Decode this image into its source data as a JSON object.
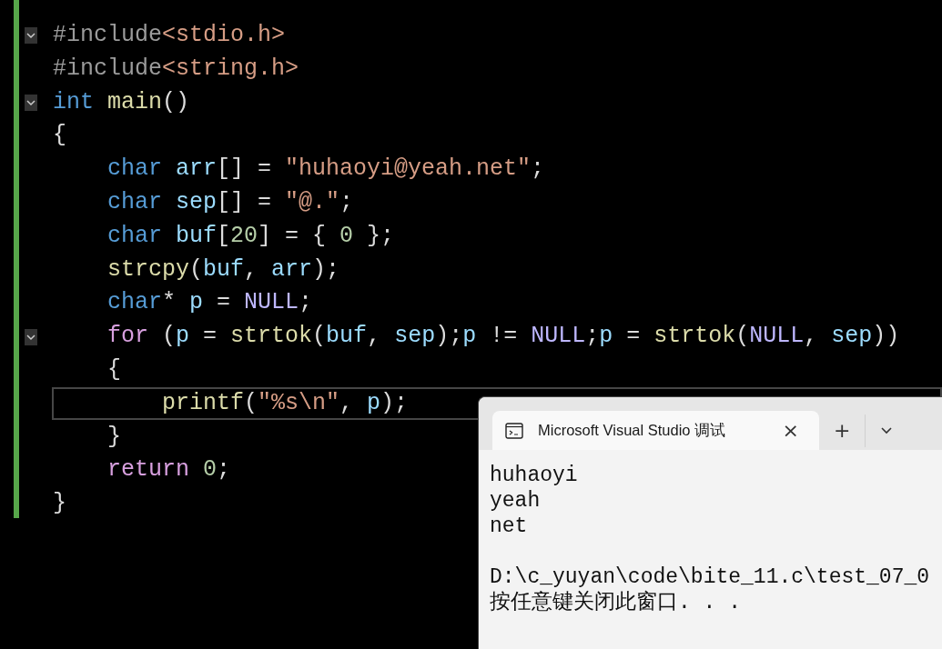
{
  "editor": {
    "lines": [
      {
        "expanded": true,
        "tokens": [
          {
            "kind": "pp",
            "text": "#include"
          },
          {
            "kind": "header",
            "text": "<stdio.h>"
          }
        ]
      },
      {
        "tokens": [
          {
            "kind": "pp",
            "text": "#include"
          },
          {
            "kind": "header",
            "text": "<string.h>"
          }
        ]
      },
      {
        "expanded": true,
        "tokens": [
          {
            "kind": "kw",
            "text": "int "
          },
          {
            "kind": "fn",
            "text": "main"
          },
          {
            "kind": "plain",
            "text": "()"
          }
        ]
      },
      {
        "tokens": [
          {
            "kind": "plain",
            "text": "{"
          }
        ]
      },
      {
        "tokens": [
          {
            "kind": "kw",
            "text": "    char "
          },
          {
            "kind": "var",
            "text": "arr"
          },
          {
            "kind": "plain",
            "text": "[] = "
          },
          {
            "kind": "str",
            "text": "\"huhaoyi@yeah.net\""
          },
          {
            "kind": "plain",
            "text": ";"
          }
        ]
      },
      {
        "tokens": [
          {
            "kind": "kw",
            "text": "    char "
          },
          {
            "kind": "var",
            "text": "sep"
          },
          {
            "kind": "plain",
            "text": "[] = "
          },
          {
            "kind": "str",
            "text": "\"@.\""
          },
          {
            "kind": "plain",
            "text": ";"
          }
        ]
      },
      {
        "tokens": [
          {
            "kind": "kw",
            "text": "    char "
          },
          {
            "kind": "var",
            "text": "buf"
          },
          {
            "kind": "plain",
            "text": "["
          },
          {
            "kind": "num",
            "text": "20"
          },
          {
            "kind": "plain",
            "text": "] = { "
          },
          {
            "kind": "num",
            "text": "0"
          },
          {
            "kind": "plain",
            "text": " };"
          }
        ]
      },
      {
        "tokens": [
          {
            "kind": "fn",
            "text": "    strcpy"
          },
          {
            "kind": "plain",
            "text": "("
          },
          {
            "kind": "var",
            "text": "buf"
          },
          {
            "kind": "plain",
            "text": ", "
          },
          {
            "kind": "var",
            "text": "arr"
          },
          {
            "kind": "plain",
            "text": ");"
          }
        ]
      },
      {
        "tokens": [
          {
            "kind": "kw",
            "text": "    char"
          },
          {
            "kind": "plain",
            "text": "* "
          },
          {
            "kind": "var",
            "text": "p"
          },
          {
            "kind": "plain",
            "text": " = "
          },
          {
            "kind": "macro",
            "text": "NULL"
          },
          {
            "kind": "plain",
            "text": ";"
          }
        ]
      },
      {
        "expanded": true,
        "tokens": [
          {
            "kind": "ctl",
            "text": "    for"
          },
          {
            "kind": "plain",
            "text": " ("
          },
          {
            "kind": "var",
            "text": "p"
          },
          {
            "kind": "plain",
            "text": " = "
          },
          {
            "kind": "fn",
            "text": "strtok"
          },
          {
            "kind": "plain",
            "text": "("
          },
          {
            "kind": "var",
            "text": "buf"
          },
          {
            "kind": "plain",
            "text": ", "
          },
          {
            "kind": "var",
            "text": "sep"
          },
          {
            "kind": "plain",
            "text": ");"
          },
          {
            "kind": "var",
            "text": "p"
          },
          {
            "kind": "plain",
            "text": " != "
          },
          {
            "kind": "macro",
            "text": "NULL"
          },
          {
            "kind": "plain",
            "text": ";"
          },
          {
            "kind": "var",
            "text": "p"
          },
          {
            "kind": "plain",
            "text": " = "
          },
          {
            "kind": "fn",
            "text": "strtok"
          },
          {
            "kind": "plain",
            "text": "("
          },
          {
            "kind": "macro",
            "text": "NULL"
          },
          {
            "kind": "plain",
            "text": ", "
          },
          {
            "kind": "var",
            "text": "sep"
          },
          {
            "kind": "plain",
            "text": "))"
          }
        ]
      },
      {
        "tokens": [
          {
            "kind": "plain",
            "text": "    {"
          }
        ]
      },
      {
        "current": true,
        "tokens": [
          {
            "kind": "fn",
            "text": "        printf"
          },
          {
            "kind": "plain",
            "text": "("
          },
          {
            "kind": "str",
            "text": "\"%s\\n\""
          },
          {
            "kind": "plain",
            "text": ", "
          },
          {
            "kind": "var",
            "text": "p"
          },
          {
            "kind": "plain",
            "text": ");"
          }
        ]
      },
      {
        "tokens": [
          {
            "kind": "plain",
            "text": "    }"
          }
        ]
      },
      {
        "tokens": [
          {
            "kind": "ctl",
            "text": "    return "
          },
          {
            "kind": "num",
            "text": "0"
          },
          {
            "kind": "plain",
            "text": ";"
          }
        ]
      },
      {
        "tokens": [
          {
            "kind": "plain",
            "text": "}"
          }
        ]
      }
    ]
  },
  "console": {
    "tab": {
      "title": "Microsoft Visual Studio 调试",
      "close": "×"
    },
    "new_tab": "+",
    "output": [
      "huhaoyi",
      "yeah",
      "net"
    ],
    "prompt": [
      "D:\\c_yuyan\\code\\bite_11.c\\test_07_0",
      "按任意键关闭此窗口. . ."
    ]
  }
}
